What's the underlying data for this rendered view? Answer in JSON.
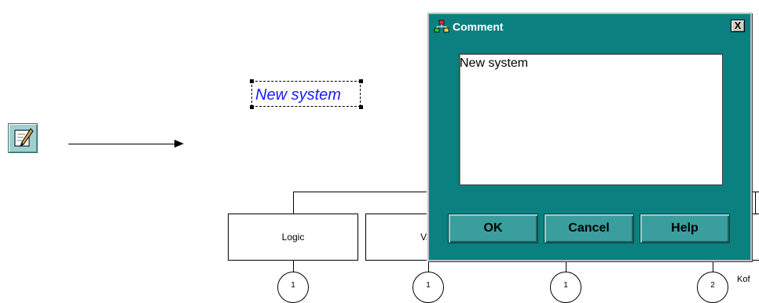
{
  "canvas": {
    "comment_text": "New system",
    "boxes": [
      {
        "label": "Logic"
      },
      {
        "label": "VAL"
      }
    ],
    "circles": [
      {
        "label": "1"
      },
      {
        "label": "1"
      },
      {
        "label": "1"
      },
      {
        "label": "2"
      }
    ],
    "bottom_right_label": "Kof"
  },
  "dialog": {
    "title": "Comment",
    "close_label": "X",
    "comment_value": "New system",
    "buttons": {
      "ok": "OK",
      "cancel": "Cancel",
      "help": "Help"
    },
    "colors": {
      "background": "#0a8080",
      "button": "#3a9e9e"
    }
  },
  "icons": {
    "tool": "edit-comment-icon",
    "title": "network-icon"
  }
}
